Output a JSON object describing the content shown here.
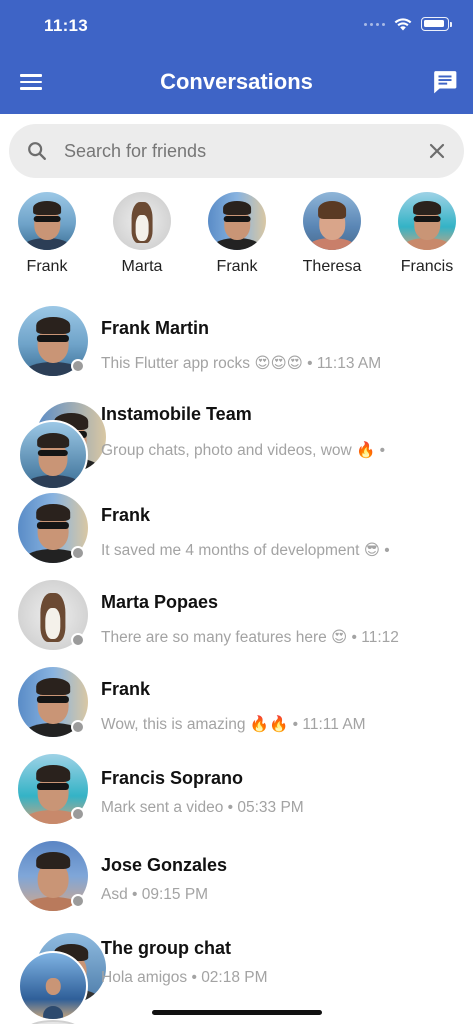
{
  "status_bar": {
    "time": "11:13"
  },
  "header": {
    "title": "Conversations"
  },
  "search": {
    "placeholder": "Search for friends",
    "value": ""
  },
  "stories": [
    {
      "name": "Frank"
    },
    {
      "name": "Marta"
    },
    {
      "name": "Frank"
    },
    {
      "name": "Theresa"
    },
    {
      "name": "Francis"
    }
  ],
  "conversations": [
    {
      "name": "Frank Martin",
      "message": "This Flutter app rocks 😍😍😍 • 11:13 AM"
    },
    {
      "name": "Instamobile Team",
      "message": "Group chats, photo and videos, wow 🔥 •"
    },
    {
      "name": "Frank",
      "message": "It saved me 4 months of development 😎 •"
    },
    {
      "name": "Marta Popaes",
      "message": "There are so many features here 😍 • 11:12"
    },
    {
      "name": "Frank",
      "message": "Wow, this is amazing 🔥🔥 • 11:11 AM"
    },
    {
      "name": "Francis Soprano",
      "message": "Mark sent a video • 05:33 PM"
    },
    {
      "name": "Jose Gonzales",
      "message": "Asd • 09:15 PM"
    },
    {
      "name": "The group chat",
      "message": "Hola amigos • 02:18 PM"
    }
  ],
  "colors": {
    "app_bar": "#3e64c6",
    "search_bg": "#ececec",
    "presence_dot": "#9b9b9b",
    "secondary_text": "#a3a3a3"
  },
  "icons": [
    "hamburger-menu-icon",
    "compose-message-icon",
    "search-icon",
    "clear-icon",
    "wifi-icon",
    "battery-icon"
  ]
}
